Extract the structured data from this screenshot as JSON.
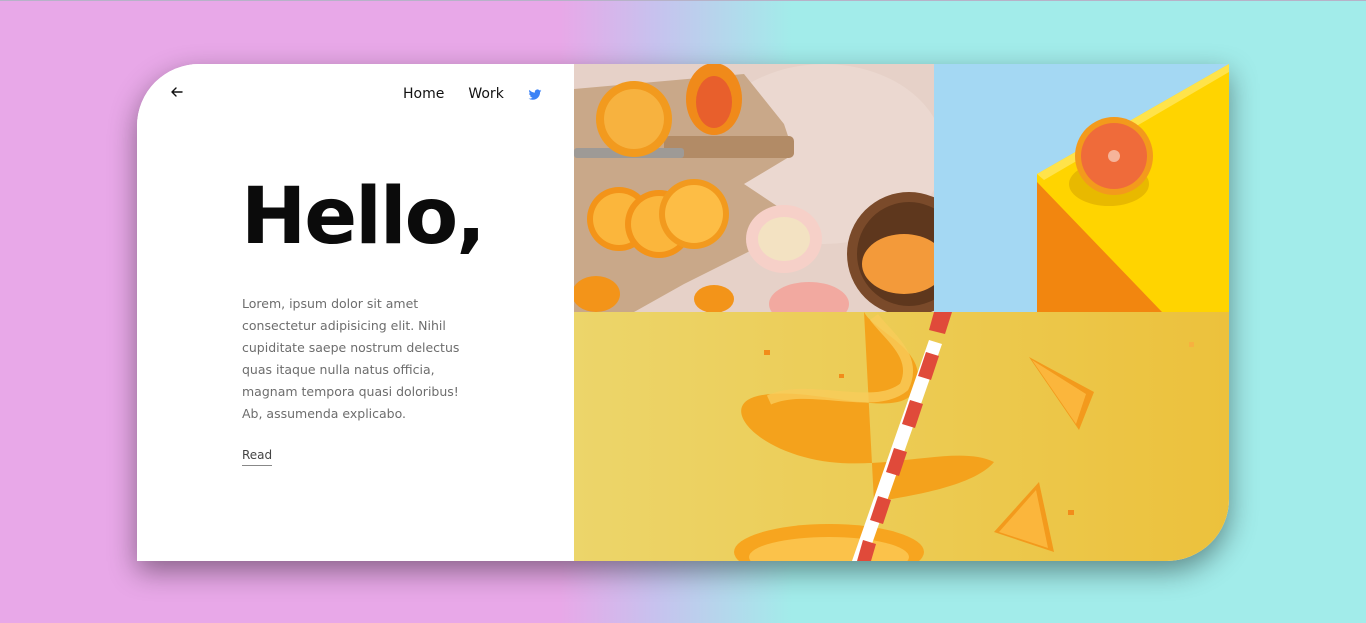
{
  "nav": {
    "back_icon": "arrow-left-icon",
    "home_label": "Home",
    "work_label": "Work",
    "social_icon": "twitter-icon",
    "social_color": "#3b82f6"
  },
  "hero": {
    "title": "Hello,",
    "body": "Lorem, ipsum dolor sit amet consectetur adipisicing elit. Nihil cupiditate saepe nostrum delectus quas itaque nulla natus officia, magnam tempora quasi doloribus! Ab, assumenda explicabo.",
    "read_label": "Read"
  },
  "gallery": {
    "images": [
      {
        "subject": "sliced oranges and apple on wooden board"
      },
      {
        "subject": "half grapefruit on yellow block against blue background"
      },
      {
        "subject": "orange peel spiral with striped straw on yellow background"
      }
    ]
  },
  "colors": {
    "background_left": "#e8a8e8",
    "background_right": "#a2ecea",
    "card": "#ffffff",
    "accent_yellow": "#f0c93a"
  }
}
